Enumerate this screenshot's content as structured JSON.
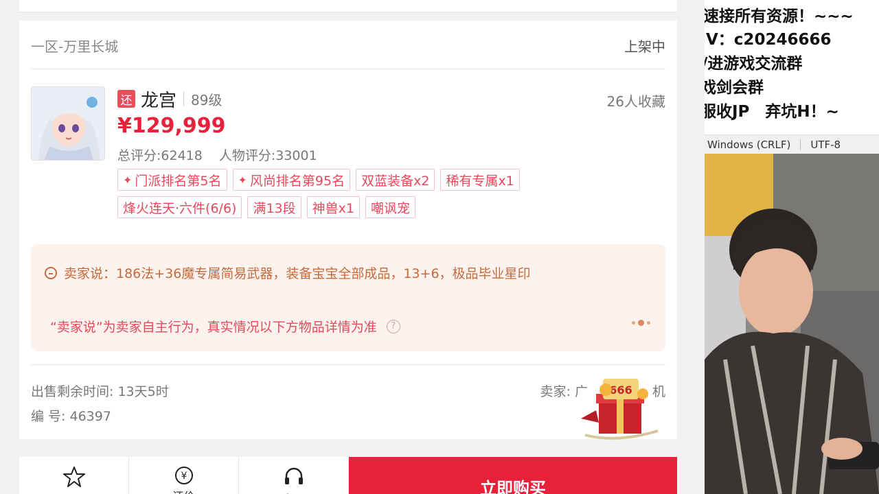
{
  "listing": {
    "server": "一区-万里长城",
    "status": "上架中",
    "tag_huan": "还",
    "char_name": "龙宫",
    "level": "89级",
    "favorites": "26人收藏",
    "price": "¥129,999",
    "total_score": "总评分:62418",
    "char_score": "人物评分:33001",
    "tags": [
      {
        "text": "门派排名第5名",
        "star": "✦"
      },
      {
        "text": "风尚排名第95名",
        "star": "✦"
      },
      {
        "text": "双蓝装备x2",
        "star": ""
      },
      {
        "text": "稀有专属x1",
        "star": ""
      },
      {
        "text": "烽火连天·六件(6/6)",
        "star": ""
      },
      {
        "text": "满13段",
        "star": ""
      },
      {
        "text": "神兽x1",
        "star": ""
      },
      {
        "text": "嘲讽宠",
        "star": ""
      }
    ],
    "seller_say": "卖家说：186法+36魔专属简易武器，装备宝宝全部成品，13+6，极品毕业星印",
    "disclaimer": "“卖家说”为卖家自主行为，真实情况以下方物品详情为准",
    "remain_time": "出售剩余时间: 13天5时",
    "serial": "编 号: 46397",
    "seller": "卖家: 广",
    "seller_tail": "机"
  },
  "bottom_bar": {
    "fav_label": "",
    "bargain_label": "还价",
    "service_label": "客服",
    "buy_label": "立即购买"
  },
  "overlay": {
    "lines": [
      "速接所有资源！~~~",
      "V：c20246666",
      "/进游戏交流群",
      "戏剑会群",
      "服收JP　弃坑H！~"
    ],
    "line_ending": "Windows (CRLF)",
    "encoding": "UTF-8"
  },
  "colors": {
    "accent": "#e8213a",
    "tag": "#e8485a",
    "seller_say": "#c66a3a"
  }
}
